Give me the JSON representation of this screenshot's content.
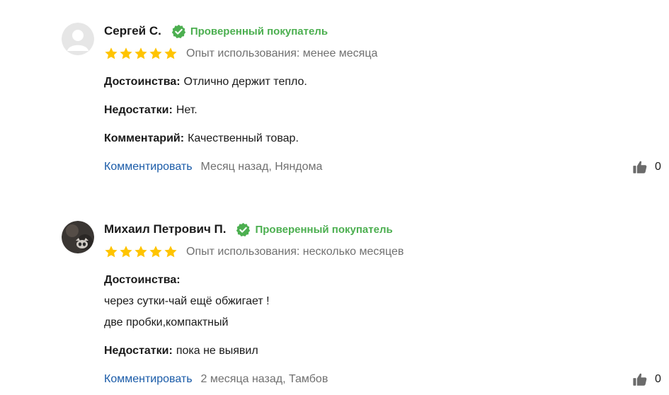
{
  "colors": {
    "verified": "#4caf50",
    "star": "#ffc400",
    "link": "#1a5ba8",
    "muted": "#707070",
    "text": "#1a1a1a"
  },
  "reviews": [
    {
      "author": "Сергей С.",
      "verified_label": "Проверенный покупатель",
      "rating": 5,
      "experience": "Опыт использования: менее месяца",
      "pros_label": "Достоинства:",
      "pros_text": "Отлично держит тепло.",
      "cons_label": "Недостатки:",
      "cons_text": "Нет.",
      "comment_label": "Комментарий:",
      "comment_text": "Качественный товар.",
      "reply_link": "Комментировать",
      "meta": "Месяц назад, Няндома",
      "likes": "0",
      "avatar_icon": "default-user-avatar",
      "like_icon": "thumbs-up-icon"
    },
    {
      "author": "Михаил Петрович П.",
      "verified_label": "Проверенный покупатель",
      "rating": 5,
      "experience": "Опыт использования: несколько месяцев",
      "pros_label": "Достоинства:",
      "pros_lines": [
        "через сутки-чай ещё обжигает !",
        "две пробки,компактный"
      ],
      "cons_label": "Недостатки:",
      "cons_text": "пока не выявил",
      "reply_link": "Комментировать",
      "meta": "2 месяца назад, Тамбов",
      "likes": "0",
      "avatar_icon": "photo-avatar",
      "like_icon": "thumbs-up-icon"
    }
  ]
}
